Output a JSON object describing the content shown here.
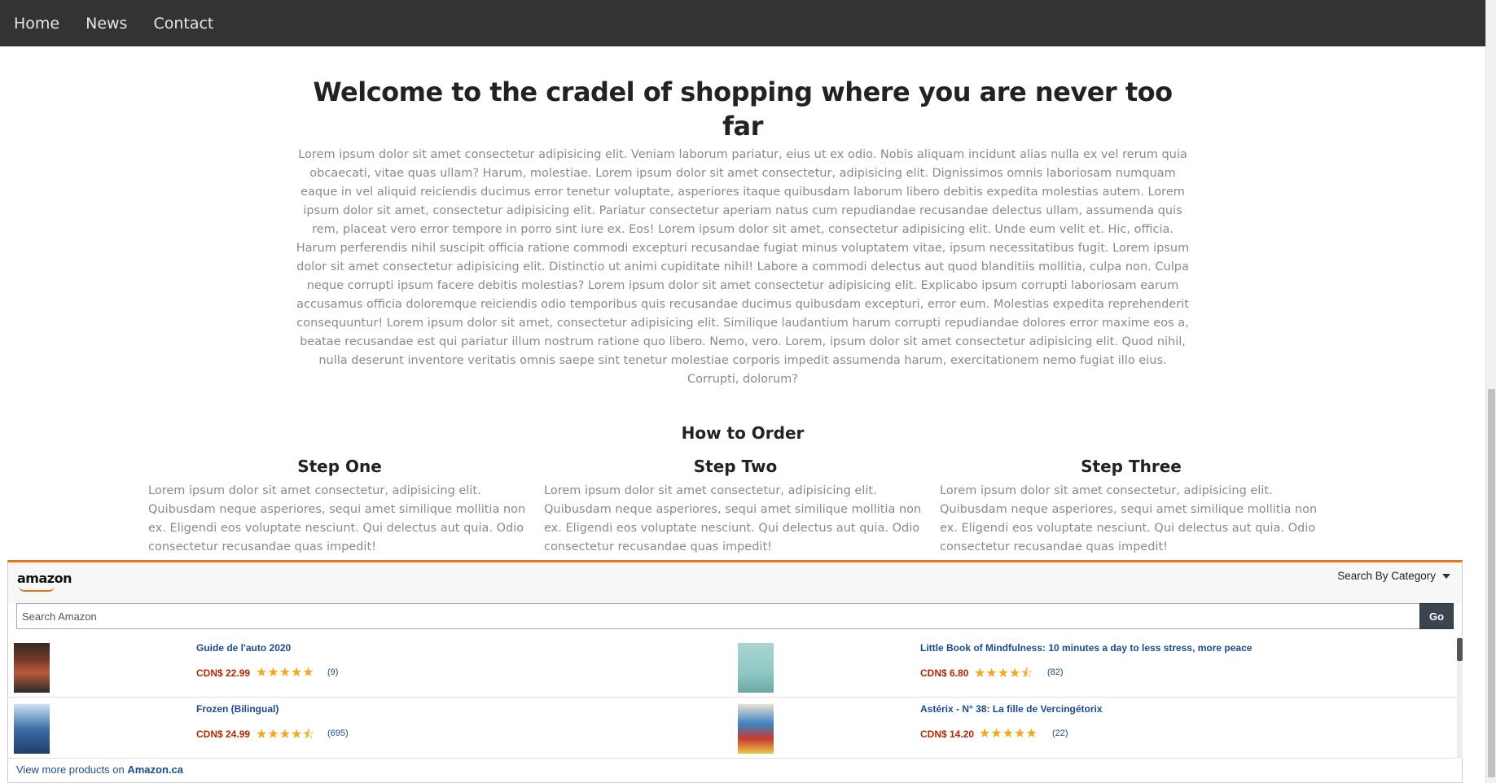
{
  "nav": {
    "items": [
      "Home",
      "News",
      "Contact"
    ]
  },
  "hero": {
    "title": "Welcome to the cradel of shopping where you are never too far",
    "body": "Lorem ipsum dolor sit amet consectetur adipisicing elit. Veniam laborum pariatur, eius ut ex odio. Nobis aliquam incidunt alias nulla ex vel rerum quia obcaecati, vitae quas ullam? Harum, molestiae. Lorem ipsum dolor sit amet consectetur, adipisicing elit. Dignissimos omnis laboriosam numquam eaque in vel aliquid reiciendis ducimus error tenetur voluptate, asperiores itaque quibusdam laborum libero debitis expedita molestias autem. Lorem ipsum dolor sit amet, consectetur adipisicing elit. Pariatur consectetur aperiam natus cum repudiandae recusandae delectus ullam, assumenda quis rem, placeat vero error tempore in porro sint iure ex. Eos! Lorem ipsum dolor sit amet, consectetur adipisicing elit. Unde eum velit et. Hic, officia. Harum perferendis nihil suscipit officia ratione commodi excepturi recusandae fugiat minus voluptatem vitae, ipsum necessitatibus fugit. Lorem ipsum dolor sit amet consectetur adipisicing elit. Distinctio ut animi cupiditate nihil! Labore a commodi delectus aut quod blanditiis mollitia, culpa non. Culpa neque corrupti ipsum facere debitis molestias? Lorem ipsum dolor sit amet consectetur adipisicing elit. Explicabo ipsum corrupti laboriosam earum accusamus officia doloremque reiciendis odio temporibus quis recusandae ducimus quibusdam excepturi, error eum. Molestias expedita reprehenderit consequuntur! Lorem ipsum dolor sit amet, consectetur adipisicing elit. Similique laudantium harum corrupti repudiandae dolores error maxime eos a, beatae recusandae est qui pariatur illum nostrum ratione quo libero. Nemo, vero. Lorem, ipsum dolor sit amet consectetur adipisicing elit. Quod nihil, nulla deserunt inventore veritatis omnis saepe sint tenetur molestiae corporis impedit assumenda harum, exercitationem nemo fugiat illo eius. Corrupti, dolorum?"
  },
  "how_to_order": {
    "title": "How to Order",
    "steps": [
      {
        "title": "Step One",
        "body": "Lorem ipsum dolor sit amet consectetur, adipisicing elit. Quibusdam neque asperiores, sequi amet similique mollitia non ex. Eligendi eos voluptate nesciunt. Qui delectus aut quia. Odio consectetur recusandae quas impedit!"
      },
      {
        "title": "Step Two",
        "body": "Lorem ipsum dolor sit amet consectetur, adipisicing elit. Quibusdam neque asperiores, sequi amet similique mollitia non ex. Eligendi eos voluptate nesciunt. Qui delectus aut quia. Odio consectetur recusandae quas impedit!"
      },
      {
        "title": "Step Three",
        "body": "Lorem ipsum dolor sit amet consectetur, adipisicing elit. Quibusdam neque asperiores, sequi amet similique mollitia non ex. Eligendi eos voluptate nesciunt. Qui delectus aut quia. Odio consectetur recusandae quas impedit!"
      }
    ]
  },
  "amazon_widget": {
    "logo_text": "amazon",
    "category_label": "Search By Category",
    "search_placeholder": "Search Amazon",
    "go_label": "Go",
    "products": [
      {
        "title": "Guide de l'auto 2020",
        "price": "CDN$ 22.99",
        "stars": "★★★★★",
        "reviews": "(9)",
        "thumb_color": "#7a3a2a"
      },
      {
        "title": "Little Book of Mindfulness: 10 minutes a day to less stress, more peace",
        "price": "CDN$ 6.80",
        "stars": "★★★★⯪",
        "reviews": "(82)",
        "thumb_color": "#8fc7c4"
      },
      {
        "title": "Frozen (Bilingual)",
        "price": "CDN$ 24.99",
        "stars": "★★★★⯪",
        "reviews": "(695)",
        "thumb_color": "#3d6ea8"
      },
      {
        "title": "Astérix - N° 38: La fille de Vercingétorix",
        "price": "CDN$ 14.20",
        "stars": "★★★★★",
        "reviews": "(22)",
        "thumb_color": "#3b83c4"
      }
    ],
    "footer_prefix": "View more products on ",
    "footer_link": "Amazon.ca",
    "accent_color": "#e47911"
  }
}
